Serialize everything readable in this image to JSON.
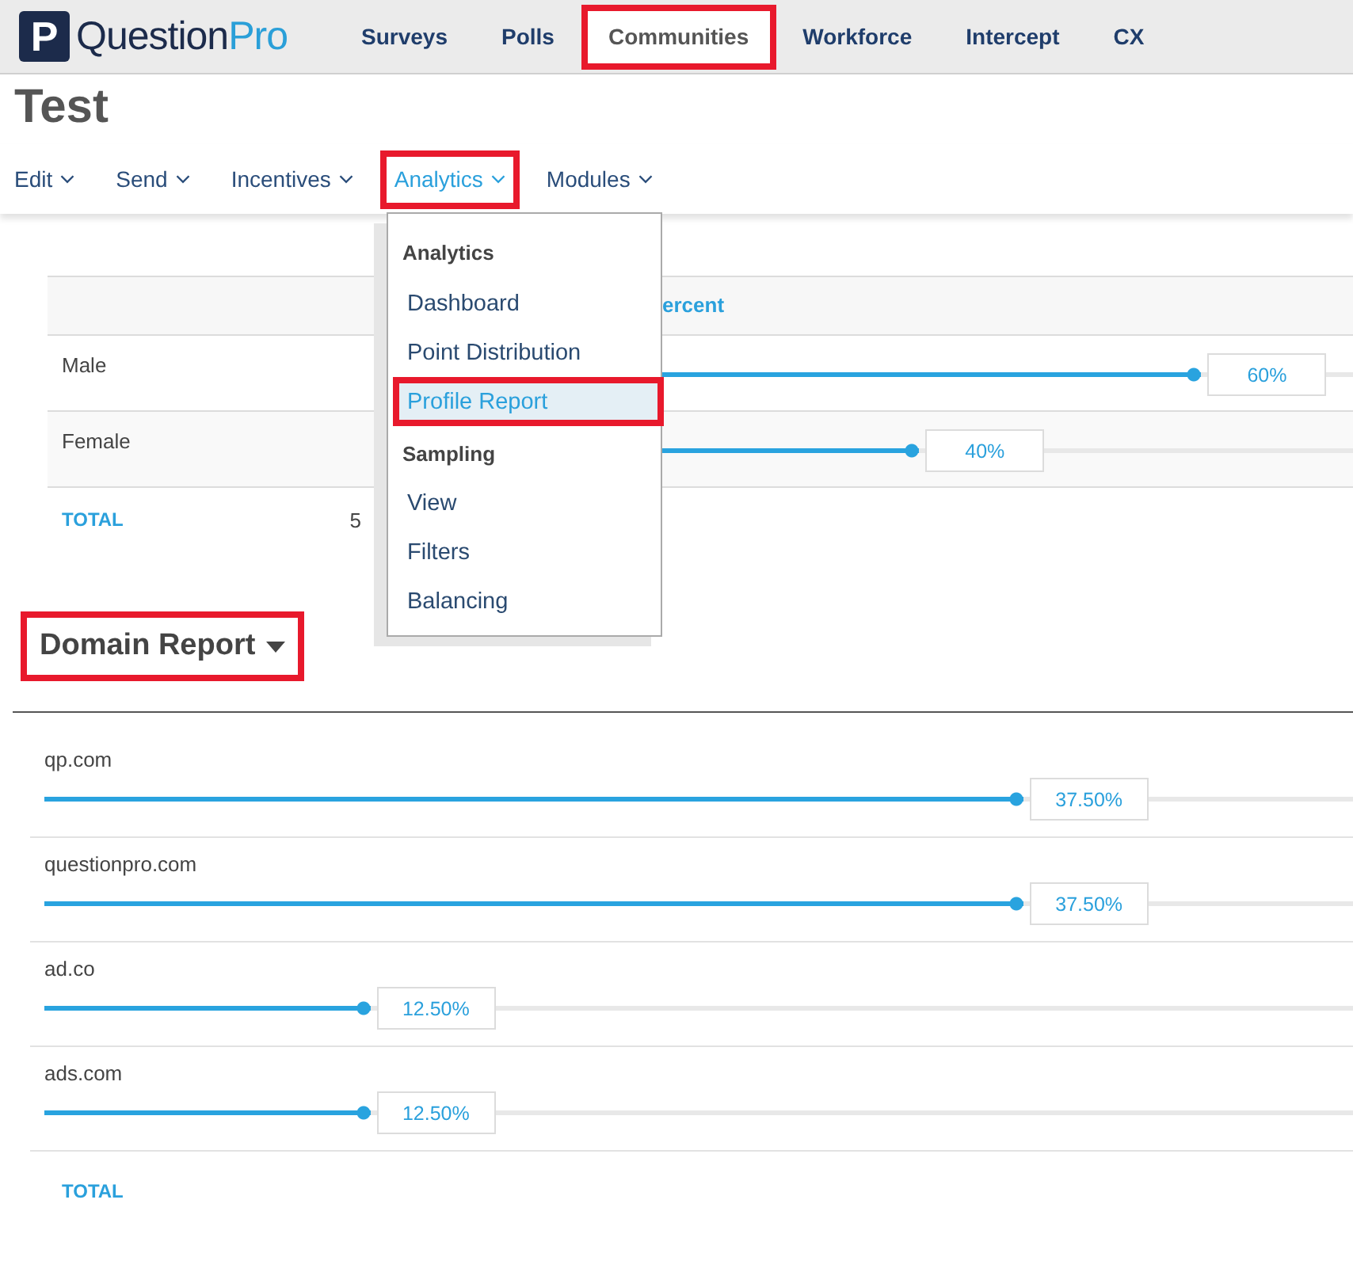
{
  "logo": {
    "mark": "P",
    "text": "Question",
    "accent": "Pro"
  },
  "top_nav": [
    {
      "label": "Surveys",
      "selected": false,
      "highlighted": false
    },
    {
      "label": "Polls",
      "selected": false,
      "highlighted": false
    },
    {
      "label": "Communities",
      "selected": true,
      "highlighted": true
    },
    {
      "label": "Workforce",
      "selected": false,
      "highlighted": false
    },
    {
      "label": "Intercept",
      "selected": false,
      "highlighted": false
    },
    {
      "label": "CX",
      "selected": false,
      "highlighted": false
    }
  ],
  "page_title": "Test",
  "sub_nav": [
    {
      "label": "Edit",
      "selected": false,
      "highlighted": false
    },
    {
      "label": "Send",
      "selected": false,
      "highlighted": false
    },
    {
      "label": "Incentives",
      "selected": false,
      "highlighted": false
    },
    {
      "label": "Analytics",
      "selected": true,
      "highlighted": true
    },
    {
      "label": "Modules",
      "selected": false,
      "highlighted": false
    }
  ],
  "analytics_menu": [
    {
      "kind": "header",
      "label": "Analytics"
    },
    {
      "kind": "item",
      "label": "Dashboard",
      "selected": false,
      "highlighted": false
    },
    {
      "kind": "item",
      "label": "Point Distribution",
      "selected": false,
      "highlighted": false
    },
    {
      "kind": "item",
      "label": "Profile Report",
      "selected": true,
      "highlighted": true
    },
    {
      "kind": "header",
      "label": "Sampling"
    },
    {
      "kind": "item",
      "label": "View",
      "selected": false,
      "highlighted": false
    },
    {
      "kind": "item",
      "label": "Filters",
      "selected": false,
      "highlighted": false
    },
    {
      "kind": "item",
      "label": "Balancing",
      "selected": false,
      "highlighted": false
    }
  ],
  "gender_table": {
    "column_header": "ercent",
    "rows": [
      {
        "label": "Male",
        "level": 0.844,
        "percent": "60%"
      },
      {
        "label": "Female",
        "level": 0.554,
        "percent": "40%"
      }
    ],
    "total": {
      "label": "TOTAL",
      "count": "5"
    }
  },
  "domain_report": {
    "title": "Domain Report",
    "highlighted": true,
    "rows": [
      {
        "label": "qp.com",
        "level": 0.748,
        "percent": "37.50%"
      },
      {
        "label": "questionpro.com",
        "level": 0.748,
        "percent": "37.50%"
      },
      {
        "label": "ad.co",
        "level": 0.249,
        "percent": "12.50%"
      },
      {
        "label": "ads.com",
        "level": 0.249,
        "percent": "12.50%"
      }
    ],
    "total": {
      "label": "TOTAL"
    }
  }
}
